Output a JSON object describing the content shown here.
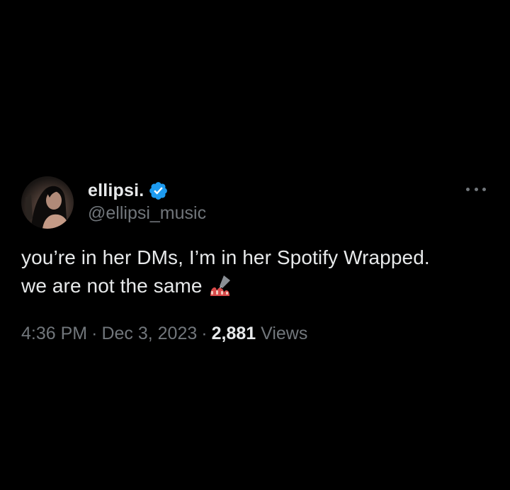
{
  "tweet": {
    "display_name": "ellipsi.",
    "handle": "@ellipsi_music",
    "verified_icon": "verified-badge-icon",
    "more_icon": "more-options-icon",
    "text_line_1": "you’re in her DMs, I’m in her Spotify Wrapped.",
    "text_line_2": "we are not the same",
    "emoji_icon": "nail-polish-emoji",
    "time": "4:36 PM",
    "separator": "·",
    "date": "Dec 3, 2023",
    "views_count": "2,881",
    "views_label": "Views"
  },
  "colors": {
    "background": "#000000",
    "primary_text": "#e7e9ea",
    "secondary_text": "#71767b",
    "verified_blue": "#1d9bf0"
  }
}
